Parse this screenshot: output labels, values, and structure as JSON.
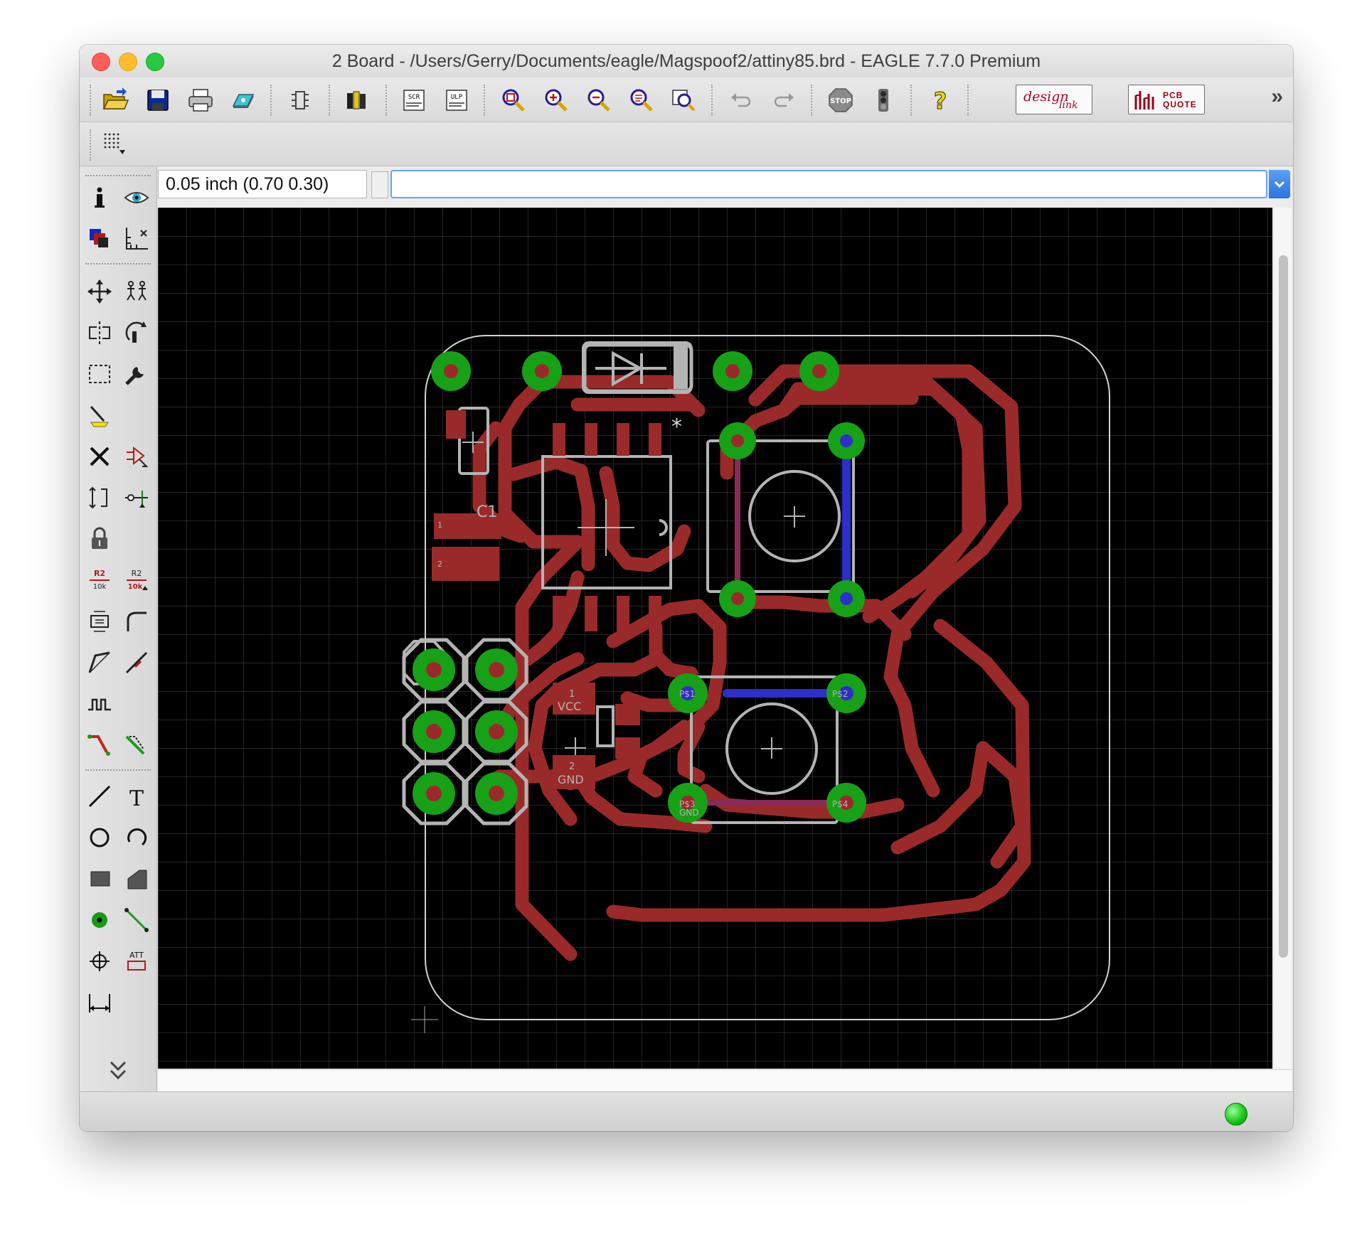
{
  "window": {
    "title": "2 Board - /Users/Gerry/Documents/eagle/Magspoof2/attiny85.brd - EAGLE 7.7.0 Premium"
  },
  "toolbar": {
    "items": [
      "open-icon",
      "save-icon",
      "print-icon",
      "cam-processor-icon",
      "switch-to-schematic-icon",
      "library-icon",
      "script-icon",
      "run-ulp-icon",
      "zoom-to-fit-icon",
      "zoom-in-icon",
      "zoom-out-icon",
      "redraw-icon",
      "zoom-select-icon",
      "undo-icon",
      "redo-icon",
      "stop-icon",
      "go-icon",
      "help-icon"
    ],
    "design_link_label": "design",
    "design_link_sub": "link",
    "pcb_quote_label": "PCB QUOTE",
    "overflow": "»"
  },
  "toolbar2": {
    "items": [
      "grid-icon"
    ]
  },
  "command": {
    "coordinates": "0.05 inch (0.70 0.30)",
    "input_value": ""
  },
  "left_tools": [
    "info-icon",
    "show-icon",
    "display-layers-icon",
    "mark-icon",
    "move-icon",
    "copy-icon",
    "mirror-icon",
    "rotate-icon",
    "group-icon",
    "change-icon",
    "paste-icon",
    "delete-icon",
    "add-icon",
    "replace-icon",
    "split-icon",
    "optimize-icon",
    "lock-icon",
    "name-icon",
    "value-icon",
    "smash-icon",
    "miter-icon",
    "split-wire-icon",
    "meander-icon",
    "route-icon",
    "ripup-icon",
    "wire-icon",
    "text-icon",
    "circle-icon",
    "arc-icon",
    "rect-icon",
    "polygon-icon",
    "via-icon",
    "signal-icon",
    "hole-icon",
    "attribute-icon",
    "dimension-icon",
    "more-tools-icon"
  ],
  "board": {
    "silk_labels": [
      "1",
      "VCC",
      "2",
      "GND",
      "1",
      "2",
      "C1",
      "P$1",
      "P$2",
      "P$3",
      "P$4",
      "GND"
    ],
    "marker": "*"
  },
  "colors": {
    "copper_top": "#9a2a2a",
    "copper_bottom": "#2e2ec8",
    "pad": "#17a117",
    "silkscreen": "#b4b4b4",
    "outline": "#d2d2d2",
    "grid": "#3a3a3a",
    "status_ok": "#19c919"
  }
}
